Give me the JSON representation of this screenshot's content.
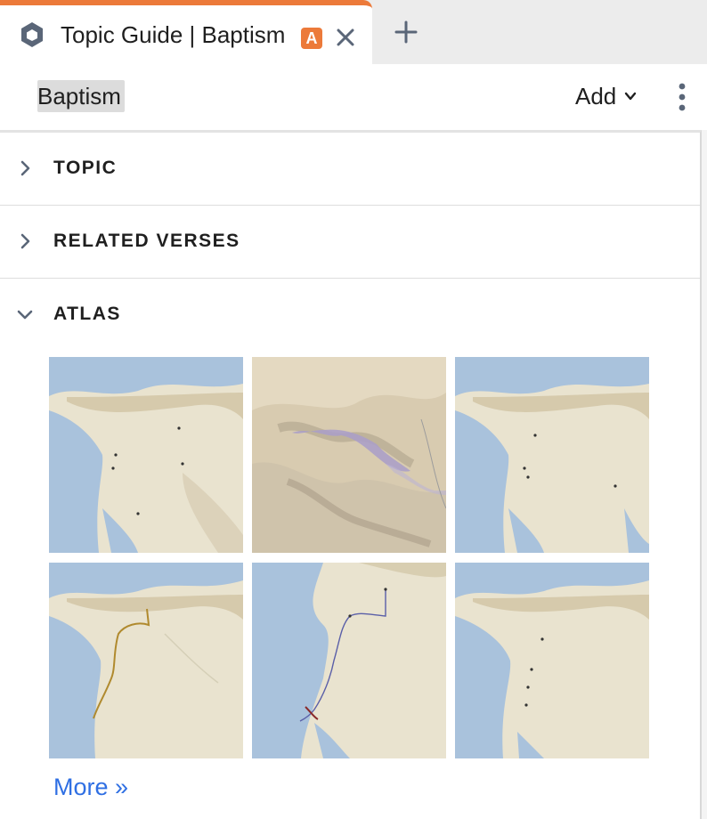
{
  "tab": {
    "title": "Topic Guide | Baptism",
    "badge": "A",
    "icon": "hexagon-logo-icon",
    "accent_color": "#ec7a3a"
  },
  "header": {
    "search_value": "Baptism",
    "add_label": "Add"
  },
  "sections": [
    {
      "label": "TOPIC",
      "expanded": false
    },
    {
      "label": "RELATED VERSES",
      "expanded": false
    },
    {
      "label": "ATLAS",
      "expanded": true
    }
  ],
  "atlas": {
    "map_count": 6,
    "more_label": "More »"
  },
  "colors": {
    "link": "#2f6fe3",
    "land": "#e8e2cf",
    "water": "#a9c2dc"
  }
}
